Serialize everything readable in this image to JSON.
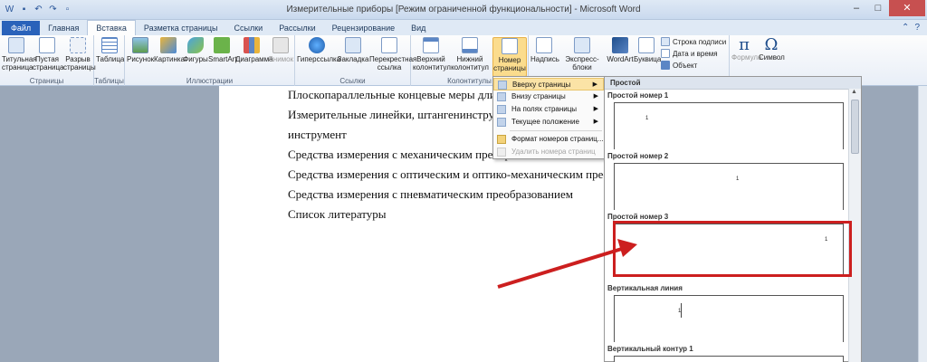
{
  "window": {
    "title": "Измерительные приборы [Режим ограниченной функциональности] - Microsoft Word"
  },
  "tabs": [
    {
      "label": "Файл"
    },
    {
      "label": "Главная"
    },
    {
      "label": "Вставка"
    },
    {
      "label": "Разметка страницы"
    },
    {
      "label": "Ссылки"
    },
    {
      "label": "Рассылки"
    },
    {
      "label": "Рецензирование"
    },
    {
      "label": "Вид"
    }
  ],
  "ribbon": {
    "pages": {
      "cover": "Титульная страница",
      "blank": "Пустая страница",
      "break": "Разрыв страницы",
      "label": "Страницы"
    },
    "tables": {
      "table": "Таблица",
      "label": "Таблицы"
    },
    "illustrations": {
      "picture": "Рисунок",
      "clipart": "Картинка",
      "shapes": "Фигуры",
      "smartart": "SmartArt",
      "chart": "Диаграмма",
      "screenshot": "Снимок",
      "label": "Иллюстрации"
    },
    "links": {
      "hyperlink": "Гиперссылка",
      "bookmark": "Закладка",
      "crossref": "Перекрестная ссылка",
      "label": "Ссылки"
    },
    "headerfooter": {
      "header": "Верхний колонтитул",
      "footer": "Нижний колонтитул",
      "pagenumber": "Номер страницы",
      "label": "Колонтитулы"
    },
    "text": {
      "textbox": "Надпись",
      "quickparts": "Экспресс-блоки",
      "wordart": "WordArt",
      "dropcap": "Буквица",
      "signature": "Строка подписи",
      "datetime": "Дата и время",
      "object": "Объект"
    },
    "symbols": {
      "equation": "Формула",
      "symbol": "Символ",
      "pi": "π",
      "omega": "Ω"
    }
  },
  "document": {
    "lines": [
      "Плоскопараллельные концевые меры длины",
      "Измерительные линейки, штангенинструмент",
      "инструмент",
      "Средства измерения с механическим преобразованием",
      "Средства измерения с оптическим и оптико-механическим преобразованием",
      "Средства измерения с пневматическим преобразованием",
      "Список литературы"
    ]
  },
  "menu": {
    "items": [
      {
        "label": "Вверху страницы"
      },
      {
        "label": "Внизу страницы"
      },
      {
        "label": "На полях страницы"
      },
      {
        "label": "Текущее положение"
      },
      {
        "label": "Формат номеров страниц..."
      },
      {
        "label": "Удалить номера страниц"
      }
    ]
  },
  "gallery": {
    "header": "Простой",
    "items": [
      {
        "label": "Простой номер 1",
        "num": "1"
      },
      {
        "label": "Простой номер 2",
        "num": "1"
      },
      {
        "label": "Простой номер 3",
        "num": "1"
      },
      {
        "label": "Вертикальная линия",
        "num": "1"
      },
      {
        "label": "Вертикальный контур 1",
        "num": ""
      }
    ]
  },
  "colors": {
    "accent": "#2a62ba",
    "highlight": "#fbdc8d",
    "callout": "#cc1f1f"
  }
}
